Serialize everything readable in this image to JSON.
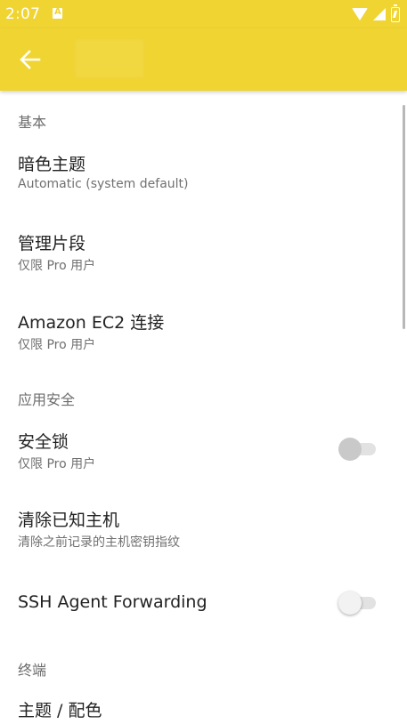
{
  "status_bar": {
    "time": "2:07",
    "notification_icon": "a-box-icon",
    "icons": [
      "wifi-icon",
      "signal-icon",
      "battery-charging-icon"
    ]
  },
  "toolbar": {
    "back_icon": "arrow-left-icon",
    "background_color": "#f0d432"
  },
  "sections": {
    "basic": "基本",
    "app_security": "应用安全",
    "terminal": "终端"
  },
  "prefs": {
    "dark_theme": {
      "title": "暗色主题",
      "summary": "Automatic (system default)"
    },
    "manage_snippets": {
      "title": "管理片段",
      "summary": "仅限 Pro 用户"
    },
    "ec2": {
      "title": "Amazon EC2 连接",
      "summary": "仅限 Pro 用户"
    },
    "security_lock": {
      "title": "安全锁",
      "summary": "仅限 Pro 用户",
      "enabled": false
    },
    "clear_hosts": {
      "title": "清除已知主机",
      "summary": "清除之前记录的主机密钥指纹"
    },
    "ssh_agent": {
      "title": "SSH Agent Forwarding",
      "enabled": false
    },
    "theme": {
      "title": "主题 / 配色"
    }
  }
}
